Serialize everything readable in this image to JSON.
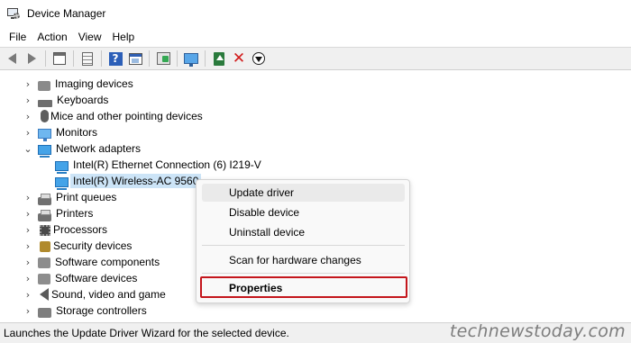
{
  "window": {
    "title": "Device Manager",
    "icon": "device-manager-icon"
  },
  "menu": [
    "File",
    "Action",
    "View",
    "Help"
  ],
  "toolbar": {
    "icons": [
      "back-arrow-icon",
      "forward-arrow-icon",
      "show-hide-console-tree-icon",
      "properties-icon",
      "help-icon",
      "action-pane-icon",
      "scan-hardware-icon",
      "computer-monitor-icon",
      "update-driver-icon",
      "uninstall-device-icon",
      "disable-device-icon"
    ],
    "uninstall_color": "#d11a1a",
    "update_color": "#2a7a3c"
  },
  "tree": {
    "items": [
      {
        "label": "Imaging devices",
        "icon": "imaging-device-icon",
        "expanded": false
      },
      {
        "label": "Keyboards",
        "icon": "keyboard-icon",
        "expanded": false
      },
      {
        "label": "Mice and other pointing devices",
        "icon": "mouse-icon",
        "expanded": false
      },
      {
        "label": "Monitors",
        "icon": "monitor-icon",
        "expanded": false
      },
      {
        "label": "Network adapters",
        "icon": "network-adapter-icon",
        "expanded": true,
        "children": [
          {
            "label": "Intel(R) Ethernet Connection (6) I219-V",
            "icon": "network-adapter-icon"
          },
          {
            "label": "Intel(R) Wireless-AC 9560",
            "icon": "network-adapter-icon",
            "selected": true
          }
        ]
      },
      {
        "label": "Print queues",
        "icon": "print-queue-icon",
        "expanded": false
      },
      {
        "label": "Printers",
        "icon": "printer-icon",
        "expanded": false
      },
      {
        "label": "Processors",
        "icon": "processor-icon",
        "expanded": false
      },
      {
        "label": "Security devices",
        "icon": "security-device-icon",
        "expanded": false
      },
      {
        "label": "Software components",
        "icon": "software-component-icon",
        "expanded": false
      },
      {
        "label": "Software devices",
        "icon": "software-device-icon",
        "expanded": false
      },
      {
        "label": "Sound, video and game",
        "icon": "sound-icon",
        "expanded": false
      },
      {
        "label": "Storage controllers",
        "icon": "storage-controller-icon",
        "expanded": false
      }
    ],
    "selection_color": "#cce4f7"
  },
  "context_menu": {
    "items": [
      {
        "label": "Update driver",
        "hovered": true
      },
      {
        "label": "Disable device"
      },
      {
        "label": "Uninstall device"
      },
      {
        "label": "Scan for hardware changes"
      },
      {
        "label": "Properties",
        "bold": true,
        "highlighted_box": true
      }
    ],
    "highlight_box_color": "#c4161c"
  },
  "statusbar": {
    "text": "Launches the Update Driver Wizard for the selected device."
  },
  "watermark": {
    "text": "technewstoday.com"
  }
}
